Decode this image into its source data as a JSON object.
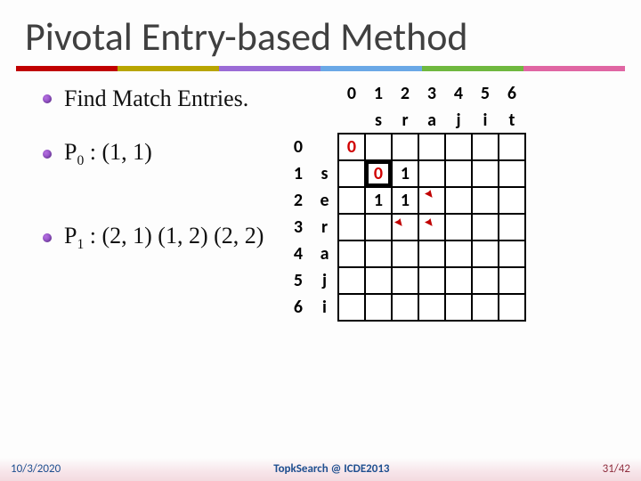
{
  "title": "Pivotal Entry-based Method",
  "bullets": {
    "find": "Find Match Entries.",
    "p0_prefix": "P",
    "p0_sub": "0",
    "p0_rest": " : (1, 1)",
    "p1_prefix": "P",
    "p1_sub": "1",
    "p1_rest": " : (2, 1) (1, 2) (2, 2)"
  },
  "matrix": {
    "col_idx": [
      "0",
      "1",
      "2",
      "3",
      "4",
      "5",
      "6"
    ],
    "col_lbl": [
      "",
      "s",
      "r",
      "a",
      "j",
      "i",
      "t"
    ],
    "row_idx": [
      "0",
      "1",
      "2",
      "3",
      "4",
      "5",
      "6"
    ],
    "row_lbl": [
      "",
      "s",
      "e",
      "r",
      "a",
      "j",
      "i"
    ],
    "cells": {
      "r0c0": "0",
      "r1c1": "0",
      "r1c2": "1",
      "r2c1": "1",
      "r2c2": "1"
    }
  },
  "footer": {
    "date": "10/3/2020",
    "center": "TopkSearch @ ICDE2013",
    "page": "31/42"
  },
  "chart_data": {
    "type": "table",
    "title": "Edit-distance DP matrix snippet (serai vs srajit)",
    "row_labels": [
      "0",
      "1 s",
      "2 e",
      "3 r",
      "4 a",
      "5 j",
      "6 i"
    ],
    "col_labels": [
      "0",
      "1 s",
      "2 r",
      "3 a",
      "4 j",
      "5 i",
      "6 t"
    ],
    "shown_values": {
      "(0,0)": 0,
      "(1,1)": 0,
      "(1,2)": 1,
      "(2,1)": 1,
      "(2,2)": 1
    },
    "highlighted_cell": "(1,1)",
    "annotations": [
      "P0 : (1,1)",
      "P1 : (2,1) (1,2) (2,2)"
    ]
  }
}
